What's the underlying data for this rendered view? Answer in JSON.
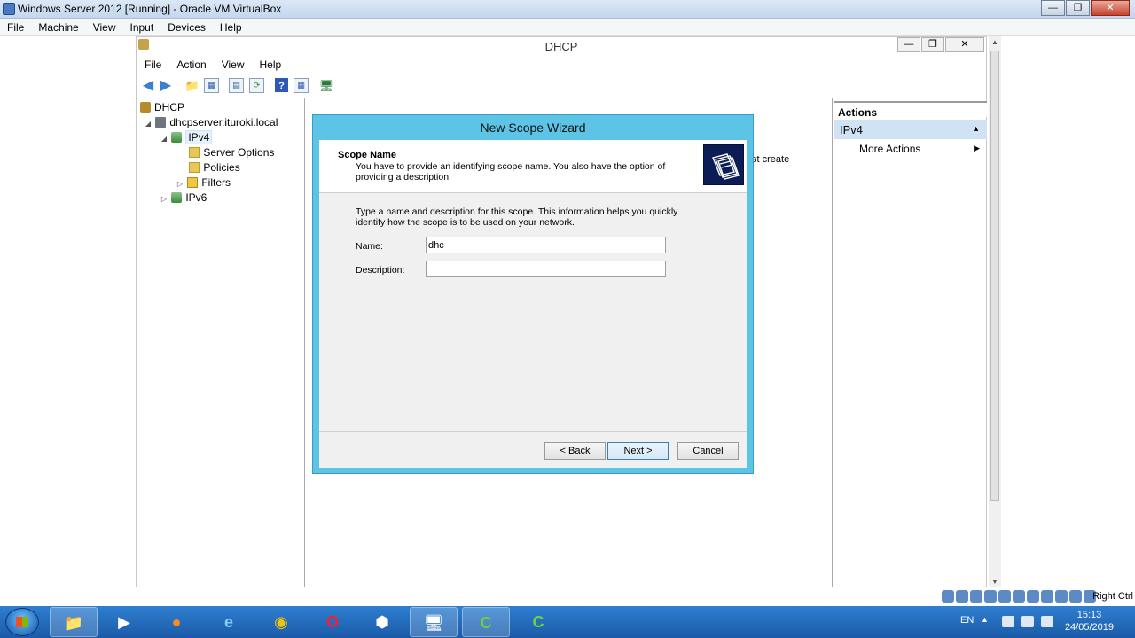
{
  "host": {
    "title": "Windows Server 2012 [Running] - Oracle VM VirtualBox",
    "menu": [
      "File",
      "Machine",
      "View",
      "Input",
      "Devices",
      "Help"
    ],
    "minimize": "—",
    "maximize": "❐",
    "close": "✕",
    "host_key": "Right Ctrl"
  },
  "mmc": {
    "title": "DHCP",
    "menu": [
      "File",
      "Action",
      "View",
      "Help"
    ],
    "tree": {
      "root": "DHCP",
      "server": "dhcpserver.ituroki.local",
      "ipv4": "IPv4",
      "server_options": "Server Options",
      "policies": "Policies",
      "filters": "Filters",
      "ipv6": "IPv6"
    },
    "center_partial_text": "st create",
    "actions": {
      "header": "Actions",
      "section": "IPv4",
      "more_actions": "More Actions"
    }
  },
  "wizard": {
    "title": "New Scope Wizard",
    "heading": "Scope Name",
    "subheading": "You have to provide an identifying scope name. You also have the option of providing a description.",
    "instructions": "Type a name and description for this scope. This information helps you quickly identify how the scope is to be used on your network.",
    "name_label": "Name:",
    "name_value": "dhc",
    "description_label": "Description:",
    "description_value": "",
    "back": "< Back",
    "next": "Next >",
    "cancel": "Cancel"
  },
  "taskbar": {
    "language": "EN",
    "time": "15:13",
    "date": "24/05/2019",
    "apps": [
      {
        "name": "file-explorer",
        "active": true
      },
      {
        "name": "media-player",
        "active": false
      },
      {
        "name": "firefox",
        "active": false
      },
      {
        "name": "internet-explorer",
        "active": false
      },
      {
        "name": "chrome",
        "active": false
      },
      {
        "name": "opera",
        "active": false
      },
      {
        "name": "virtualbox",
        "active": false
      },
      {
        "name": "server-2016-image",
        "active": true
      },
      {
        "name": "camtasia-1",
        "active": true
      },
      {
        "name": "camtasia-2",
        "active": false
      }
    ]
  },
  "colors": {
    "wizard_frame": "#5dc4e6",
    "taskbar": "#1a5aa8",
    "actions_highlight": "#cfe3f5"
  }
}
